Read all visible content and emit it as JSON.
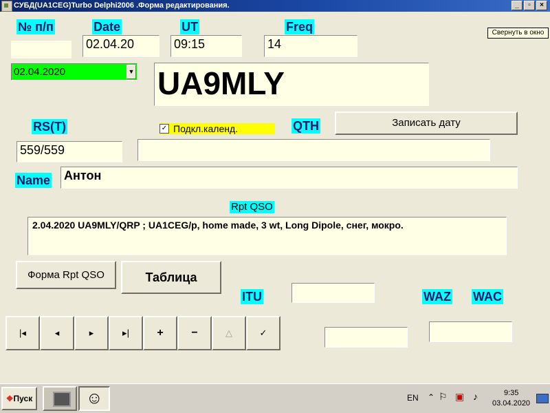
{
  "window": {
    "title": "СУБД(UA1CEG)Turbo  Delphi2006 .Форма редактирования.",
    "minimize": "_",
    "maximize": "▫",
    "close": "×"
  },
  "tooltip": "Свернуть в окно",
  "labels": {
    "num": "№ п/п",
    "date": "Date",
    "ut": "UT",
    "freq": "Freq",
    "rst": "RS(T)",
    "qth": "QTH",
    "name": "Name",
    "rpt_qso": "Rpt  QSO",
    "itu": "ITU",
    "waz": "WAZ",
    "wac": "WAC"
  },
  "fields": {
    "num": "",
    "date": "02.04.20",
    "ut": "09:15",
    "freq": "14",
    "date_picker": "02.04.2020",
    "callsign": "UA9MLY",
    "rst": "559/559",
    "qth": "",
    "name": "Антон",
    "rpt_qso": "2.04.2020 UA9MLY/QRP ;  UA1CEG/p, home made, 3 wt, Long Dipole, снег, мокро.",
    "itu": "",
    "waz": "",
    "wac": ""
  },
  "checkbox": {
    "label": "Подкл.календ.",
    "checked": true
  },
  "buttons": {
    "save_date": "Записать дату",
    "form_rpt": "Форма Rpt QSO",
    "table": "Таблица"
  },
  "navigator": [
    "|◂",
    "◂",
    "▸",
    "▸|",
    "+",
    "−",
    "△",
    "✓"
  ],
  "taskbar": {
    "start": "Пуск",
    "lang": "EN",
    "time": "9:35",
    "date": "03.04.2020"
  },
  "colors": {
    "label_bg": "#00ffff",
    "field_bg": "#ffffe6",
    "date_picker_bg": "#00ff00",
    "checkbox_bg": "#ffff00",
    "titlebar": "#0a246a"
  }
}
